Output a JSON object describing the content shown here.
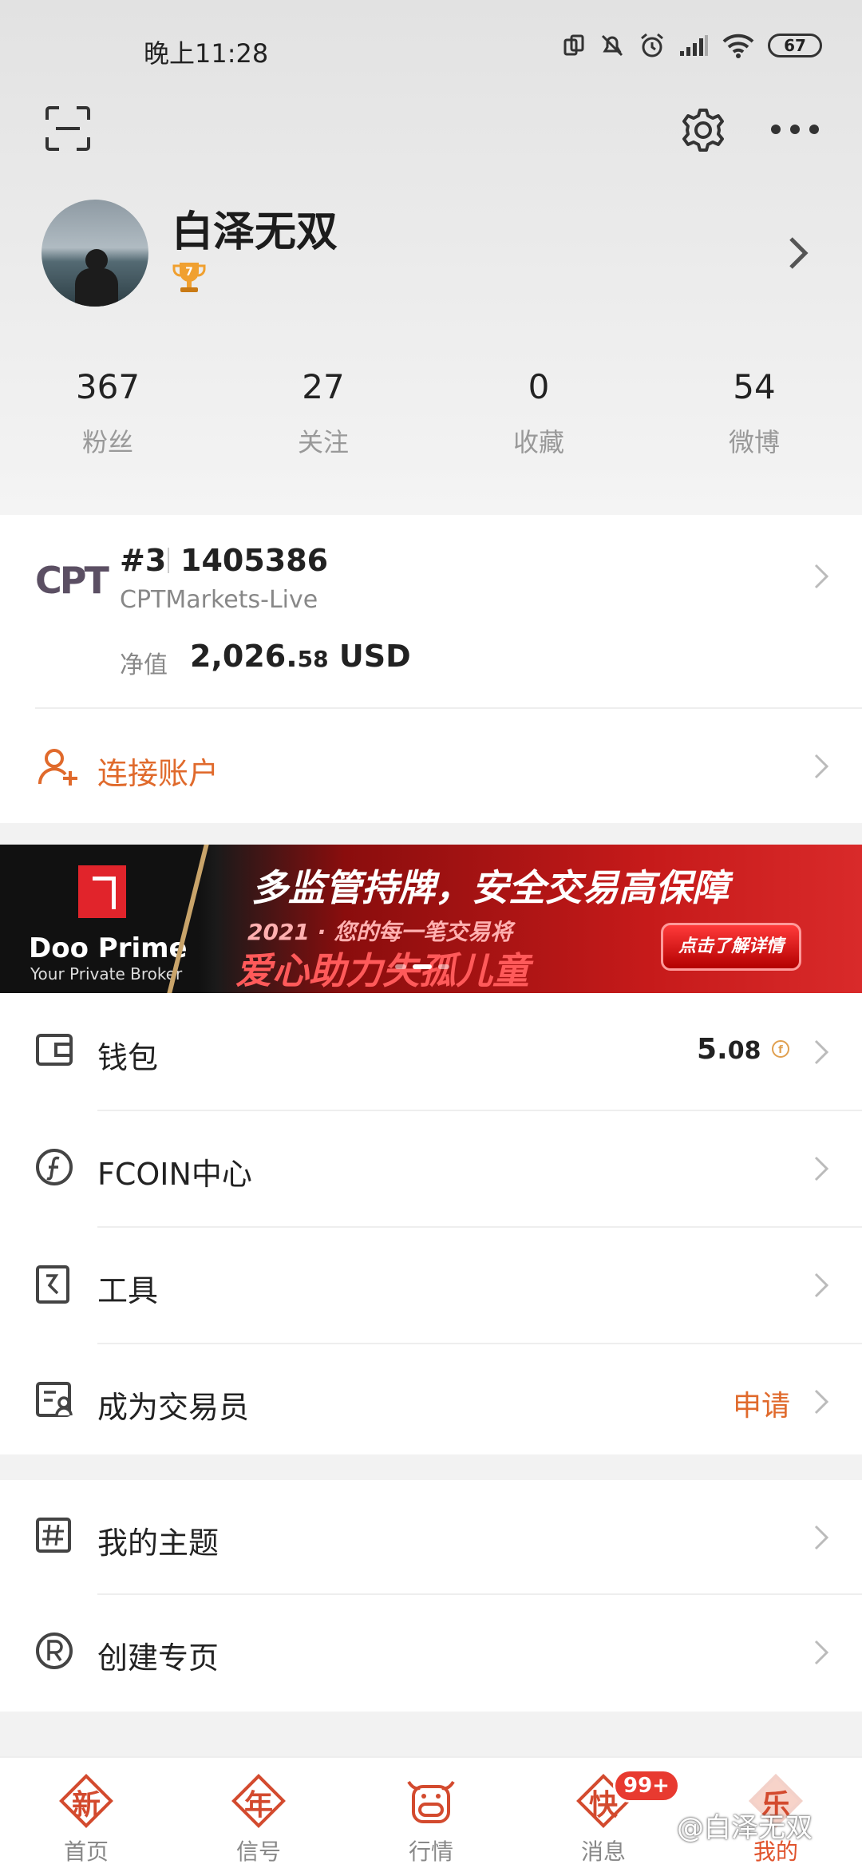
{
  "status_bar": {
    "time": "晚上11:28",
    "battery": "67"
  },
  "profile": {
    "username": "白泽无双",
    "level": "7"
  },
  "stats": [
    {
      "value": "367",
      "label": "粉丝"
    },
    {
      "value": "27",
      "label": "关注"
    },
    {
      "value": "0",
      "label": "收藏"
    },
    {
      "value": "54",
      "label": "微博"
    }
  ],
  "account": {
    "broker_logo": "CPT",
    "rank": "#3",
    "number": "1405386",
    "server": "CPTMarkets-Live",
    "equity_label": "净值",
    "equity_int": "2,026.",
    "equity_dec": "58",
    "equity_currency": " USD"
  },
  "connect": {
    "label": "连接账户"
  },
  "banner": {
    "brand": "Doo Prime",
    "tagline": "Your Private Broker",
    "line1": "多监管持牌，安全交易高保障",
    "line2": "2021 · 您的每一笔交易将",
    "line3": "爱心助力失孤儿童",
    "cta": "点击了解详情"
  },
  "menu_group1": [
    {
      "label": "钱包",
      "value_int": "5.",
      "value_dec": "08",
      "icon": "wallet-icon"
    },
    {
      "label": "FCOIN中心",
      "icon": "fcoin-icon"
    },
    {
      "label": "工具",
      "icon": "tools-icon"
    },
    {
      "label": "成为交易员",
      "action": "申请",
      "icon": "trader-icon"
    }
  ],
  "menu_group2": [
    {
      "label": "我的主题",
      "icon": "hashtag-icon"
    },
    {
      "label": "创建专页",
      "icon": "registered-icon"
    }
  ],
  "tabs": [
    {
      "char": "新",
      "label": "首页"
    },
    {
      "char": "年",
      "label": "信号"
    },
    {
      "char": "",
      "label": "行情"
    },
    {
      "char": "快",
      "label": "消息",
      "badge": "99+"
    },
    {
      "char": "乐",
      "label": "我的"
    }
  ],
  "watermark": "@白泽无双",
  "colors": {
    "accent": "#e06a2c",
    "tab_icon": "#d34a2e",
    "badge": "#e83a30"
  }
}
